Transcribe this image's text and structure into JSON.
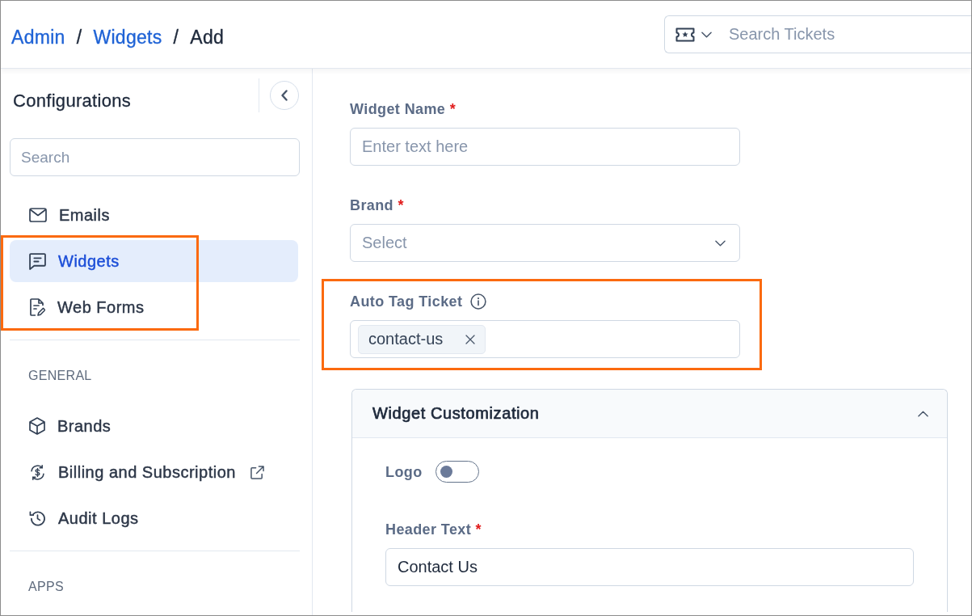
{
  "breadcrumb": {
    "items": [
      {
        "label": "Admin",
        "link": true
      },
      {
        "label": "Widgets",
        "link": true
      },
      {
        "label": "Add",
        "link": false
      }
    ],
    "separators": [
      "/",
      "/"
    ]
  },
  "ticket_search": {
    "placeholder": "Search Tickets"
  },
  "sidebar": {
    "title": "Configurations",
    "search": {
      "placeholder": "Search"
    },
    "sections": [
      {
        "items": [
          {
            "label": "Emails",
            "selected": false,
            "highlighted": false,
            "external": false
          },
          {
            "label": "Widgets",
            "selected": true,
            "highlighted": true,
            "external": false
          },
          {
            "label": "Web Forms",
            "selected": false,
            "highlighted": true,
            "external": false
          }
        ]
      },
      {
        "heading": "GENERAL",
        "items": [
          {
            "label": "Brands",
            "selected": false,
            "highlighted": false,
            "external": false
          },
          {
            "label": "Billing and Subscription",
            "selected": false,
            "highlighted": false,
            "external": true
          },
          {
            "label": "Audit Logs",
            "selected": false,
            "highlighted": false,
            "external": false
          }
        ]
      },
      {
        "heading": "APPS"
      }
    ]
  },
  "form": {
    "fields": [
      {
        "kind": "text",
        "label": "Widget Name",
        "required_mark": "*",
        "placeholder": "Enter text here",
        "info": false,
        "highlighted": false
      },
      {
        "kind": "select",
        "label": "Brand",
        "required_mark": "*",
        "placeholder": "Select",
        "info": false,
        "highlighted": false
      },
      {
        "kind": "tags",
        "label": "Auto Tag Ticket",
        "info": true,
        "tags": [
          "contact-us"
        ],
        "highlighted": true
      }
    ]
  },
  "customization": {
    "title": "Widget Customization",
    "expanded": true,
    "fields": [
      {
        "kind": "toggle",
        "label": "Logo",
        "on": false
      },
      {
        "kind": "text",
        "label": "Header Text",
        "required_mark": "*",
        "value": "Contact Us"
      }
    ]
  }
}
